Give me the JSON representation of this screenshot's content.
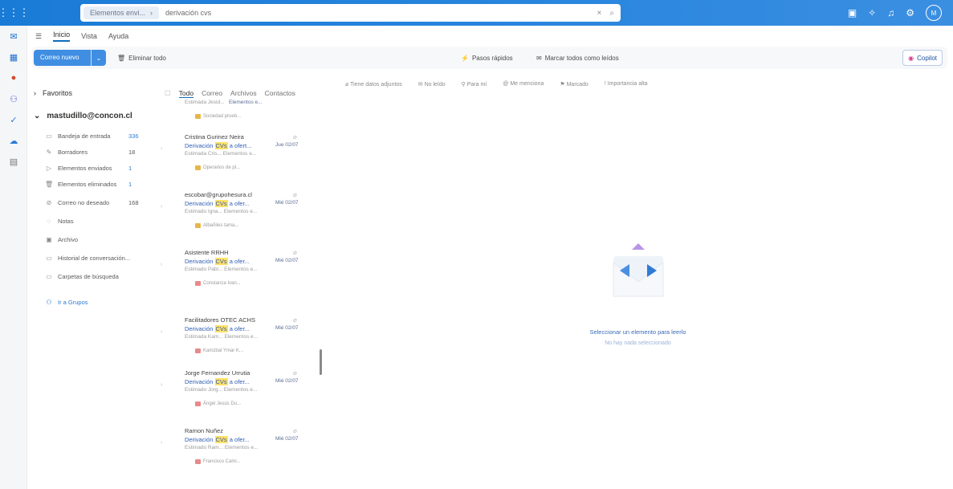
{
  "search": {
    "scope": "Elementos envi...",
    "query": "derivación cvs"
  },
  "avatar_initial": "M",
  "ribbon_tabs": [
    "Inicio",
    "Vista",
    "Ayuda"
  ],
  "ribbon": {
    "new_mail": "Correo nuevo",
    "delete_all": "Eliminar todo",
    "quick_steps": "Pasos rápidos",
    "mark_all_read": "Marcar todos como leídos",
    "copilot": "Copilot"
  },
  "folders": {
    "favorites": "Favoritos",
    "account": "mastudillo@concon.cl",
    "items": [
      {
        "label": "Bandeja de entrada",
        "count": "336"
      },
      {
        "label": "Borradores",
        "count": "18"
      },
      {
        "label": "Elementos enviados",
        "count": "1"
      },
      {
        "label": "Elementos eliminados",
        "count": "1"
      },
      {
        "label": "Correo no deseado",
        "count": "168"
      },
      {
        "label": "Notas",
        "count": ""
      },
      {
        "label": "Archivo",
        "count": ""
      },
      {
        "label": "Historial de conversación...",
        "count": ""
      },
      {
        "label": "Carpetas de búsqueda",
        "count": ""
      }
    ],
    "groups_link": "Ir a Grupos"
  },
  "list_filters": [
    "Todo",
    "Correo",
    "Archivos",
    "Contactos"
  ],
  "search_filters": [
    "Tiene datos adjuntos",
    "No leído",
    "Para mí",
    "Me menciona",
    "Marcado",
    "Importancia alta"
  ],
  "messages": [
    {
      "sender": "Estimada Jesid...",
      "subject_pre": "",
      "subject_hl": "",
      "subject_post": "",
      "date": "",
      "preview": "Elementos e...",
      "chip": "Sociedad prueb...",
      "chip_color": "gold"
    },
    {
      "sender": "Cristina Gurinez Neira",
      "subject_pre": "Derivación ",
      "subject_hl": "CVs",
      "subject_post": " a ofert...",
      "date": "Jue 02/07",
      "preview": "Estimada Cris...   Elementos e...",
      "chip": "Operarios de pl...",
      "chip_color": "gold"
    },
    {
      "sender": "escobar@grupohesura.cl",
      "subject_pre": "Derivación ",
      "subject_hl": "CVs",
      "subject_post": " a ofer...",
      "date": "Mié 02/07",
      "preview": "Estimado Igna...   Elementos e...",
      "chip": "Albañiles tama...",
      "chip_color": "gold"
    },
    {
      "sender": "Asistente RRHH",
      "subject_pre": "Derivación ",
      "subject_hl": "CVs",
      "subject_post": " a ofer...",
      "date": "Mié 02/07",
      "preview": "Estimado Pabl...   Elementos e...",
      "chip": "Constanza Ivan...",
      "chip_color": "red"
    },
    {
      "sender": "Facilitadores OTEC ACHS",
      "subject_pre": "Derivación ",
      "subject_hl": "CVs",
      "subject_post": " a ofer...",
      "date": "Mié 02/07",
      "preview": "Estimada Kam...   Elementos e...",
      "chip": "Kamzbal Ymar K...",
      "chip_color": "red"
    },
    {
      "sender": "Jorge Fernandez Urrutia",
      "subject_pre": "Derivación ",
      "subject_hl": "CVs",
      "subject_post": " a ofer...",
      "date": "Mié 02/07",
      "preview": "Estimado Jorg...   Elementos e...",
      "chip": "Ángel Jesús Du...",
      "chip_color": "red"
    },
    {
      "sender": "Ramon Nuñez",
      "subject_pre": "Derivación ",
      "subject_hl": "CVs",
      "subject_post": " a ofer...",
      "date": "Mié 02/07",
      "preview": "Estimado Ram...   Elementos e...",
      "chip": "Francisco Cami...",
      "chip_color": "red"
    }
  ],
  "reading": {
    "title": "Seleccionar un elemento para leerlo",
    "subtitle": "No hay nada seleccionado"
  }
}
